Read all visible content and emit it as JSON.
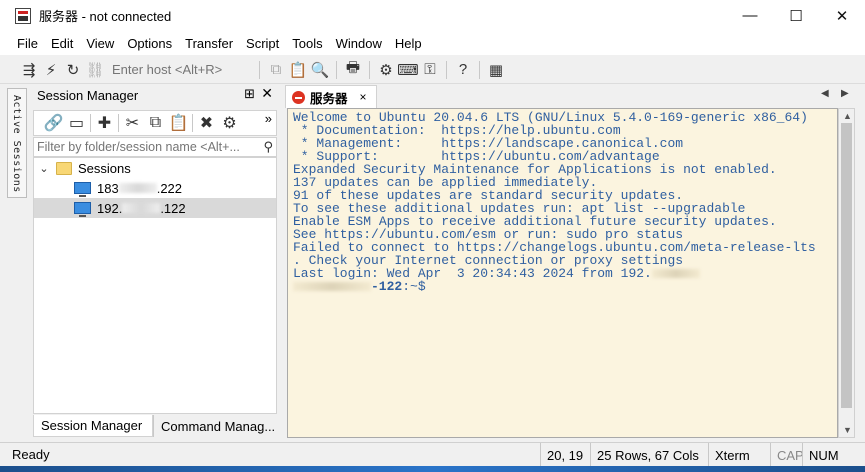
{
  "window": {
    "title": "服务器 - not connected",
    "controls": {
      "minimize": "—",
      "maximize": "☐",
      "close": "✕"
    }
  },
  "menu": [
    "File",
    "Edit",
    "View",
    "Options",
    "Transfer",
    "Script",
    "Tools",
    "Window",
    "Help"
  ],
  "toolbar": {
    "host_placeholder": "Enter host <Alt+R>",
    "icons": [
      "connect-bar-icon",
      "quick-connect-icon",
      "reconnect-icon",
      "disconnect-icon",
      "copy-icon",
      "paste-icon",
      "find-icon",
      "print-icon",
      "settings-icon",
      "keymap-icon",
      "key-icon",
      "help-icon",
      "sftp-icon"
    ]
  },
  "side_tab": {
    "label": "Active Sessions"
  },
  "session_manager": {
    "title": "Session Manager",
    "pin": "⊞",
    "close": "✕",
    "more": "»",
    "filter_placeholder": "Filter by folder/session name <Alt+...",
    "tree": {
      "folder": "Sessions",
      "items": [
        {
          "prefix": "183",
          "suffix": ".222",
          "selected": false
        },
        {
          "prefix": "192.",
          "suffix": ".122",
          "selected": true
        }
      ]
    },
    "tabs": [
      "Session Manager",
      "Command Manag..."
    ]
  },
  "terminal": {
    "tab_label": "服务器",
    "tab_close": "×",
    "lines": [
      "Welcome to Ubuntu 20.04.6 LTS (GNU/Linux 5.4.0-169-generic x86_64)",
      "",
      " * Documentation:  https://help.ubuntu.com",
      " * Management:     https://landscape.canonical.com",
      " * Support:        https://ubuntu.com/advantage",
      "",
      "Expanded Security Maintenance for Applications is not enabled.",
      "",
      "137 updates can be applied immediately.",
      "91 of these updates are standard security updates.",
      "To see these additional updates run: apt list --upgradable",
      "",
      "Enable ESM Apps to receive additional future security updates.",
      "See https://ubuntu.com/esm or run: sudo pro status",
      "",
      "Failed to connect to https://changelogs.ubuntu.com/meta-release-lts",
      ". Check your Internet connection or proxy settings",
      "",
      "Last login: Wed Apr  3 20:34:43 2024 from 192."
    ],
    "prompt_suffix": "-122",
    "prompt_tail": ":~$"
  },
  "status": {
    "ready": "Ready",
    "position": "20,  19",
    "size": "25 Rows, 67 Cols",
    "term": "Xterm",
    "cap": "CAP",
    "num": "NUM"
  }
}
